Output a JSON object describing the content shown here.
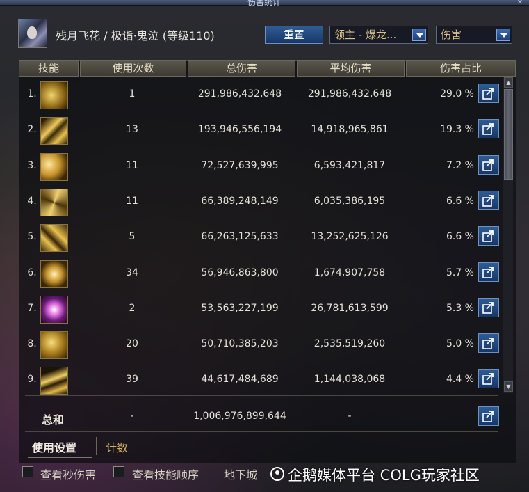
{
  "window": {
    "title": "伤害统计",
    "close_glyph": "✕"
  },
  "header": {
    "character": "残月飞花 / 极诣·鬼泣 (等级110)",
    "reset_label": "重置",
    "target_select": "领主 - 爆龙...",
    "metric_select": "伤害"
  },
  "table": {
    "columns": [
      "技能",
      "使用次数",
      "总伤害",
      "平均伤害",
      "伤害占比"
    ],
    "rows": [
      {
        "num": "1.",
        "uses": "1",
        "total": "291,986,432,648",
        "avg": "291,986,432,648",
        "share": "29.0 %",
        "icon": "skill-icon-1"
      },
      {
        "num": "2.",
        "uses": "13",
        "total": "193,946,556,194",
        "avg": "14,918,965,861",
        "share": "19.3 %",
        "icon": "skill-icon-2"
      },
      {
        "num": "3.",
        "uses": "11",
        "total": "72,527,639,995",
        "avg": "6,593,421,817",
        "share": "7.2 %",
        "icon": "skill-icon-3"
      },
      {
        "num": "4.",
        "uses": "11",
        "total": "66,389,248,149",
        "avg": "6,035,386,195",
        "share": "6.6 %",
        "icon": "skill-icon-4"
      },
      {
        "num": "5.",
        "uses": "5",
        "total": "66,263,125,633",
        "avg": "13,252,625,126",
        "share": "6.6 %",
        "icon": "skill-icon-5"
      },
      {
        "num": "6.",
        "uses": "34",
        "total": "56,946,863,800",
        "avg": "1,674,907,758",
        "share": "5.7 %",
        "icon": "skill-icon-6"
      },
      {
        "num": "7.",
        "uses": "2",
        "total": "53,563,227,199",
        "avg": "26,781,613,599",
        "share": "5.3 %",
        "icon": "skill-icon-7"
      },
      {
        "num": "8.",
        "uses": "20",
        "total": "50,710,385,203",
        "avg": "2,535,519,260",
        "share": "5.0 %",
        "icon": "skill-icon-8"
      },
      {
        "num": "9.",
        "uses": "39",
        "total": "44,617,484,689",
        "avg": "1,144,038,068",
        "share": "4.4 %",
        "icon": "skill-icon-9"
      }
    ],
    "total_row": {
      "label": "总和",
      "uses": "-",
      "total": "1,006,976,899,644",
      "avg": "-"
    }
  },
  "tabs": {
    "settings": "使用设置",
    "count": "计数"
  },
  "options": {
    "per_second": "查看秒伤害",
    "skill_order": "查看技能顺序",
    "dungeon": "地下城"
  },
  "watermark": "企鹅媒体平台 COLG玩家社区",
  "colors": {
    "accent_blue": "#2e5c96",
    "gold": "#d6b25c",
    "panel_border": "#4d4b42"
  }
}
